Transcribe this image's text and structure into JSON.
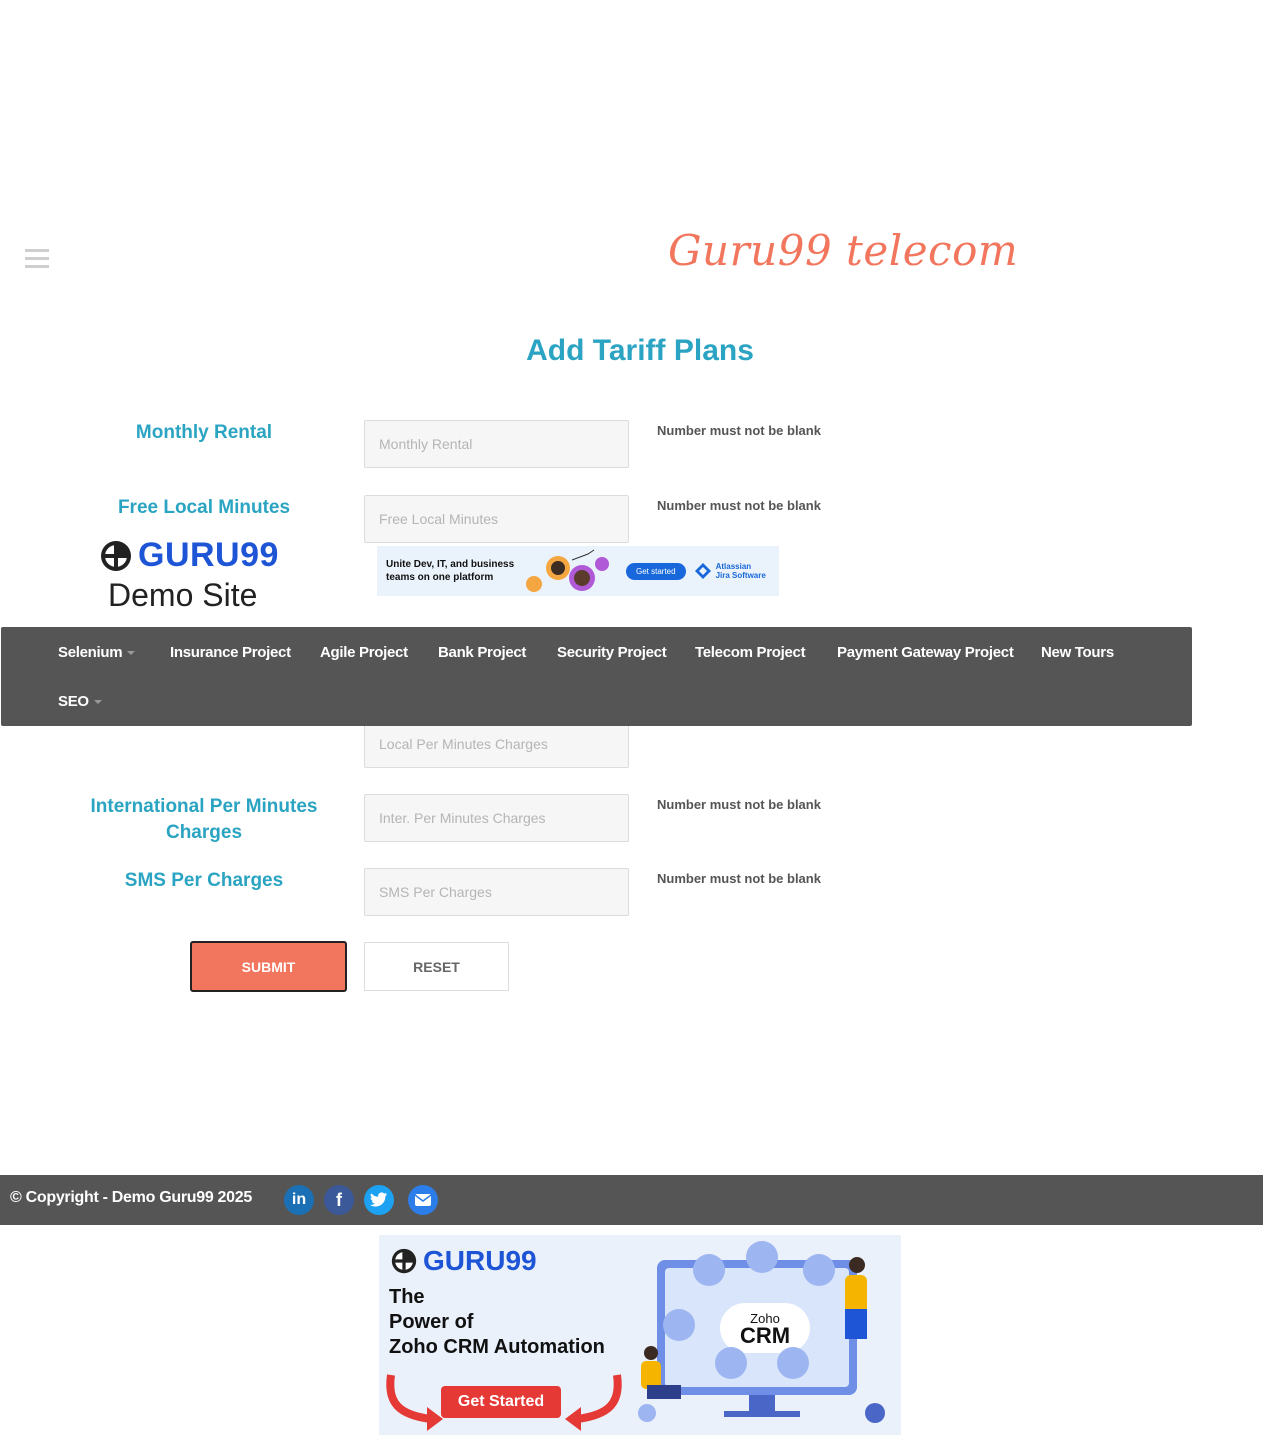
{
  "header": {
    "site_title": "Guru99 telecom"
  },
  "page": {
    "heading": "Add Tariff Plans"
  },
  "form": {
    "fields": [
      {
        "label": "Monthly Rental",
        "placeholder": "Monthly Rental",
        "value": "",
        "error": "Number must not be blank"
      },
      {
        "label": "Free Local Minutes",
        "placeholder": "Free Local Minutes",
        "value": "",
        "error": "Number must not be blank"
      },
      {
        "label": "",
        "placeholder": "Local Per Minutes Charges",
        "value": "",
        "error": ""
      },
      {
        "label": "International Per Minutes Charges",
        "placeholder": "Inter. Per Minutes Charges",
        "value": "",
        "error": "Number must not be blank"
      },
      {
        "label": "SMS Per Charges",
        "placeholder": "SMS Per Charges",
        "value": "",
        "error": "Number must not be blank"
      }
    ],
    "submit_label": "SUBMIT",
    "reset_label": "RESET"
  },
  "overlay": {
    "logo_brand": "GURU99",
    "logo_sub": "Demo Site",
    "ad": {
      "text": "Unite Dev, IT, and business teams on one platform",
      "cta": "Get started",
      "brand": "Atlassian Jira Software"
    }
  },
  "nav": {
    "items": [
      "Selenium",
      "Insurance Project",
      "Agile Project",
      "Bank Project",
      "Security Project",
      "Telecom Project",
      "Payment Gateway Project",
      "New Tours",
      "SEO"
    ]
  },
  "footer": {
    "copyright": "© Copyright - Demo Guru99 2025",
    "social_icons": [
      "linkedin-icon",
      "facebook-icon",
      "twitter-icon",
      "email-icon"
    ]
  },
  "bottom_ad": {
    "brand": "GURU99",
    "headline_1": "The",
    "headline_2": "Power of",
    "headline_3": "Zoho CRM Automation",
    "cta": "Get Started",
    "crm_1": "Zoho",
    "crm_2": "CRM"
  },
  "colors": {
    "accent": "#2aa4c2",
    "brand": "#f2765d",
    "nav_bg": "#555555"
  }
}
